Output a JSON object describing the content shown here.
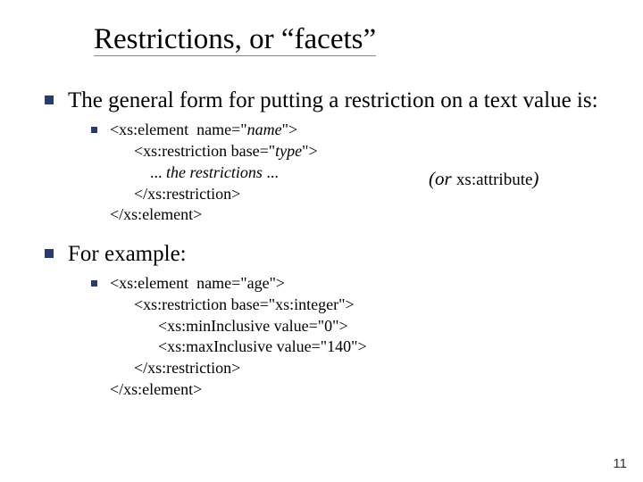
{
  "title": "Restrictions, or “facets”",
  "point1": "The general form for putting a restriction on a text value is:",
  "code1": {
    "l1a": "<xs:element  name=\"",
    "l1b": "name",
    "l1c": "\">",
    "l2a": "      <xs:restriction base=\"",
    "l2b": "type",
    "l2c": "\">",
    "l3a": "          ... ",
    "l3b": "the restrictions",
    "l3c": " ...",
    "l4": "      </xs:restriction>",
    "l5": "</xs:element>"
  },
  "aside": {
    "open": "(or ",
    "mono": "xs:attribute",
    "close": ")"
  },
  "point2": "For example:",
  "code2": {
    "l1": "<xs:element  name=\"age\">",
    "l2": "      <xs:restriction base=\"xs:integer\">",
    "l3": "            <xs:minInclusive value=\"0\">",
    "l4": "            <xs:maxInclusive value=\"140\">",
    "l5": "      </xs:restriction>",
    "l6": "</xs:element>"
  },
  "page": "11"
}
